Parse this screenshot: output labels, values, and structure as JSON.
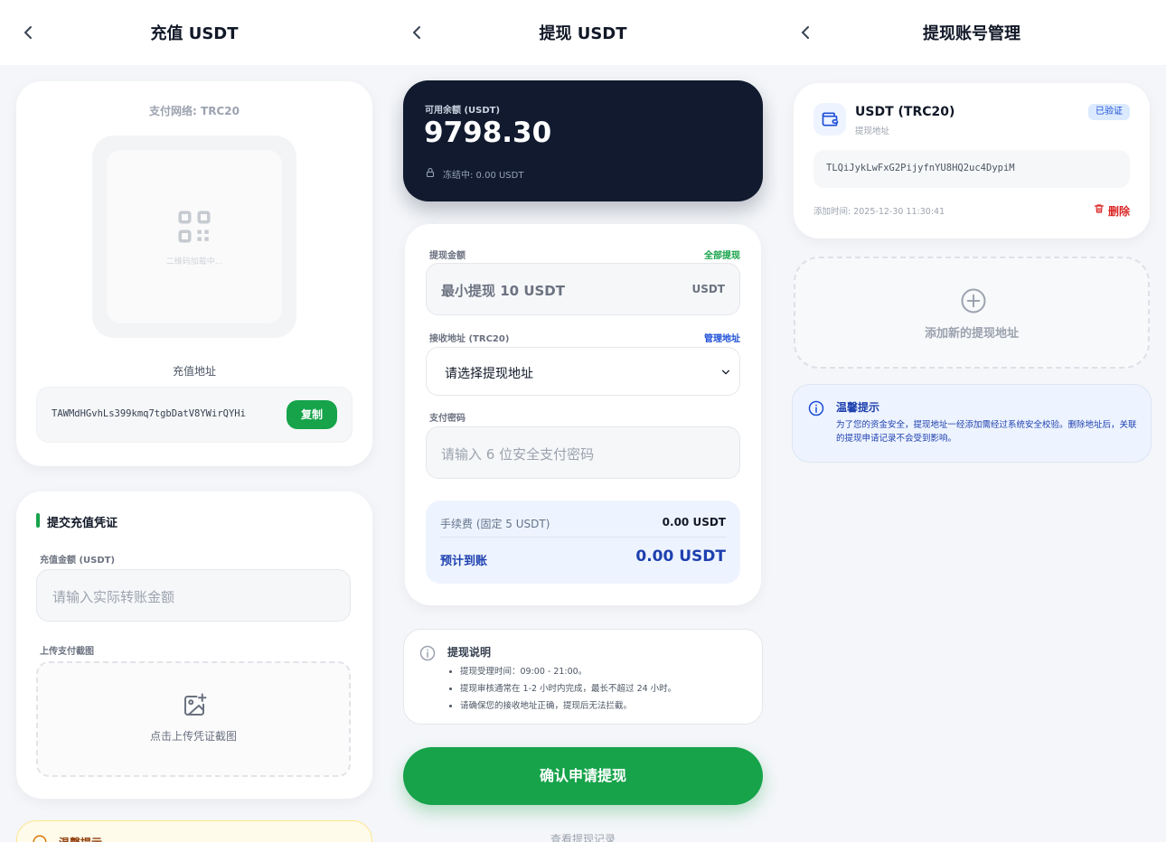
{
  "deposit": {
    "title": "充值 USDT",
    "network_label": "支付网络: TRC20",
    "qr_loading": "二维码加载中...",
    "address_title": "充值地址",
    "address": "TAWMdHGvhLs399kmq7tgbDatV8YWirQYHi",
    "copy_button": "复制",
    "proof_title": "提交充值凭证",
    "amount_label": "充值金额 (USDT)",
    "amount_placeholder": "请输入实际转账金额",
    "upload_label": "上传支付截图",
    "upload_text": "点击上传凭证截图",
    "tip_title": "温馨提示"
  },
  "withdraw": {
    "title": "提现 USDT",
    "balance_label": "可用余额 (USDT)",
    "balance": "9798.30",
    "frozen": "冻结中: 0.00 USDT",
    "amount_label": "提现金额",
    "withdraw_all": "全部提现",
    "amount_placeholder": "最小提现 10 USDT",
    "amount_unit": "USDT",
    "address_label": "接收地址 (TRC20)",
    "manage_address": "管理地址",
    "address_select": "请选择提现地址",
    "password_label": "支付密码",
    "password_placeholder": "请输入 6 位安全支付密码",
    "fee_label": "手续费 (固定 5 USDT)",
    "fee_value": "0.00 USDT",
    "expected_label": "预计到账",
    "expected_value": "0.00 USDT",
    "notes_title": "提现说明",
    "notes": [
      "提现受理时间：09:00 - 21:00。",
      "提现审核通常在 1-2 小时内完成，最长不超过 24 小时。",
      "请确保您的接收地址正确，提现后无法拦截。"
    ],
    "submit_button": "确认申请提现",
    "history_link": "查看提现记录"
  },
  "accounts": {
    "title": "提现账号管理",
    "item": {
      "name": "USDT (TRC20)",
      "sub": "提现地址",
      "badge": "已验证",
      "address": "TLQiJykLwFxG2PijyfnYU8HQ2uc4DypiM",
      "added": "添加时间: 2025-12-30 11:30:41",
      "delete": "删除"
    },
    "add_new": "添加新的提现地址",
    "tip_title": "温馨提示",
    "tip_text": "为了您的资金安全，提现地址一经添加需经过系统安全校验。删除地址后，关联的提现申请记录不会受到影响。"
  },
  "colors": {
    "green": "#16a34a",
    "blue": "#1d4ed8",
    "red": "#dc2626",
    "dark": "#111a2e",
    "badge_bg": "#dbeafe"
  },
  "icons": [
    "chevron-left-icon",
    "qr-code-icon",
    "image-upload-icon",
    "lock-icon",
    "info-icon",
    "wallet-icon",
    "trash-icon",
    "plus-circle-icon",
    "warning-icon"
  ]
}
